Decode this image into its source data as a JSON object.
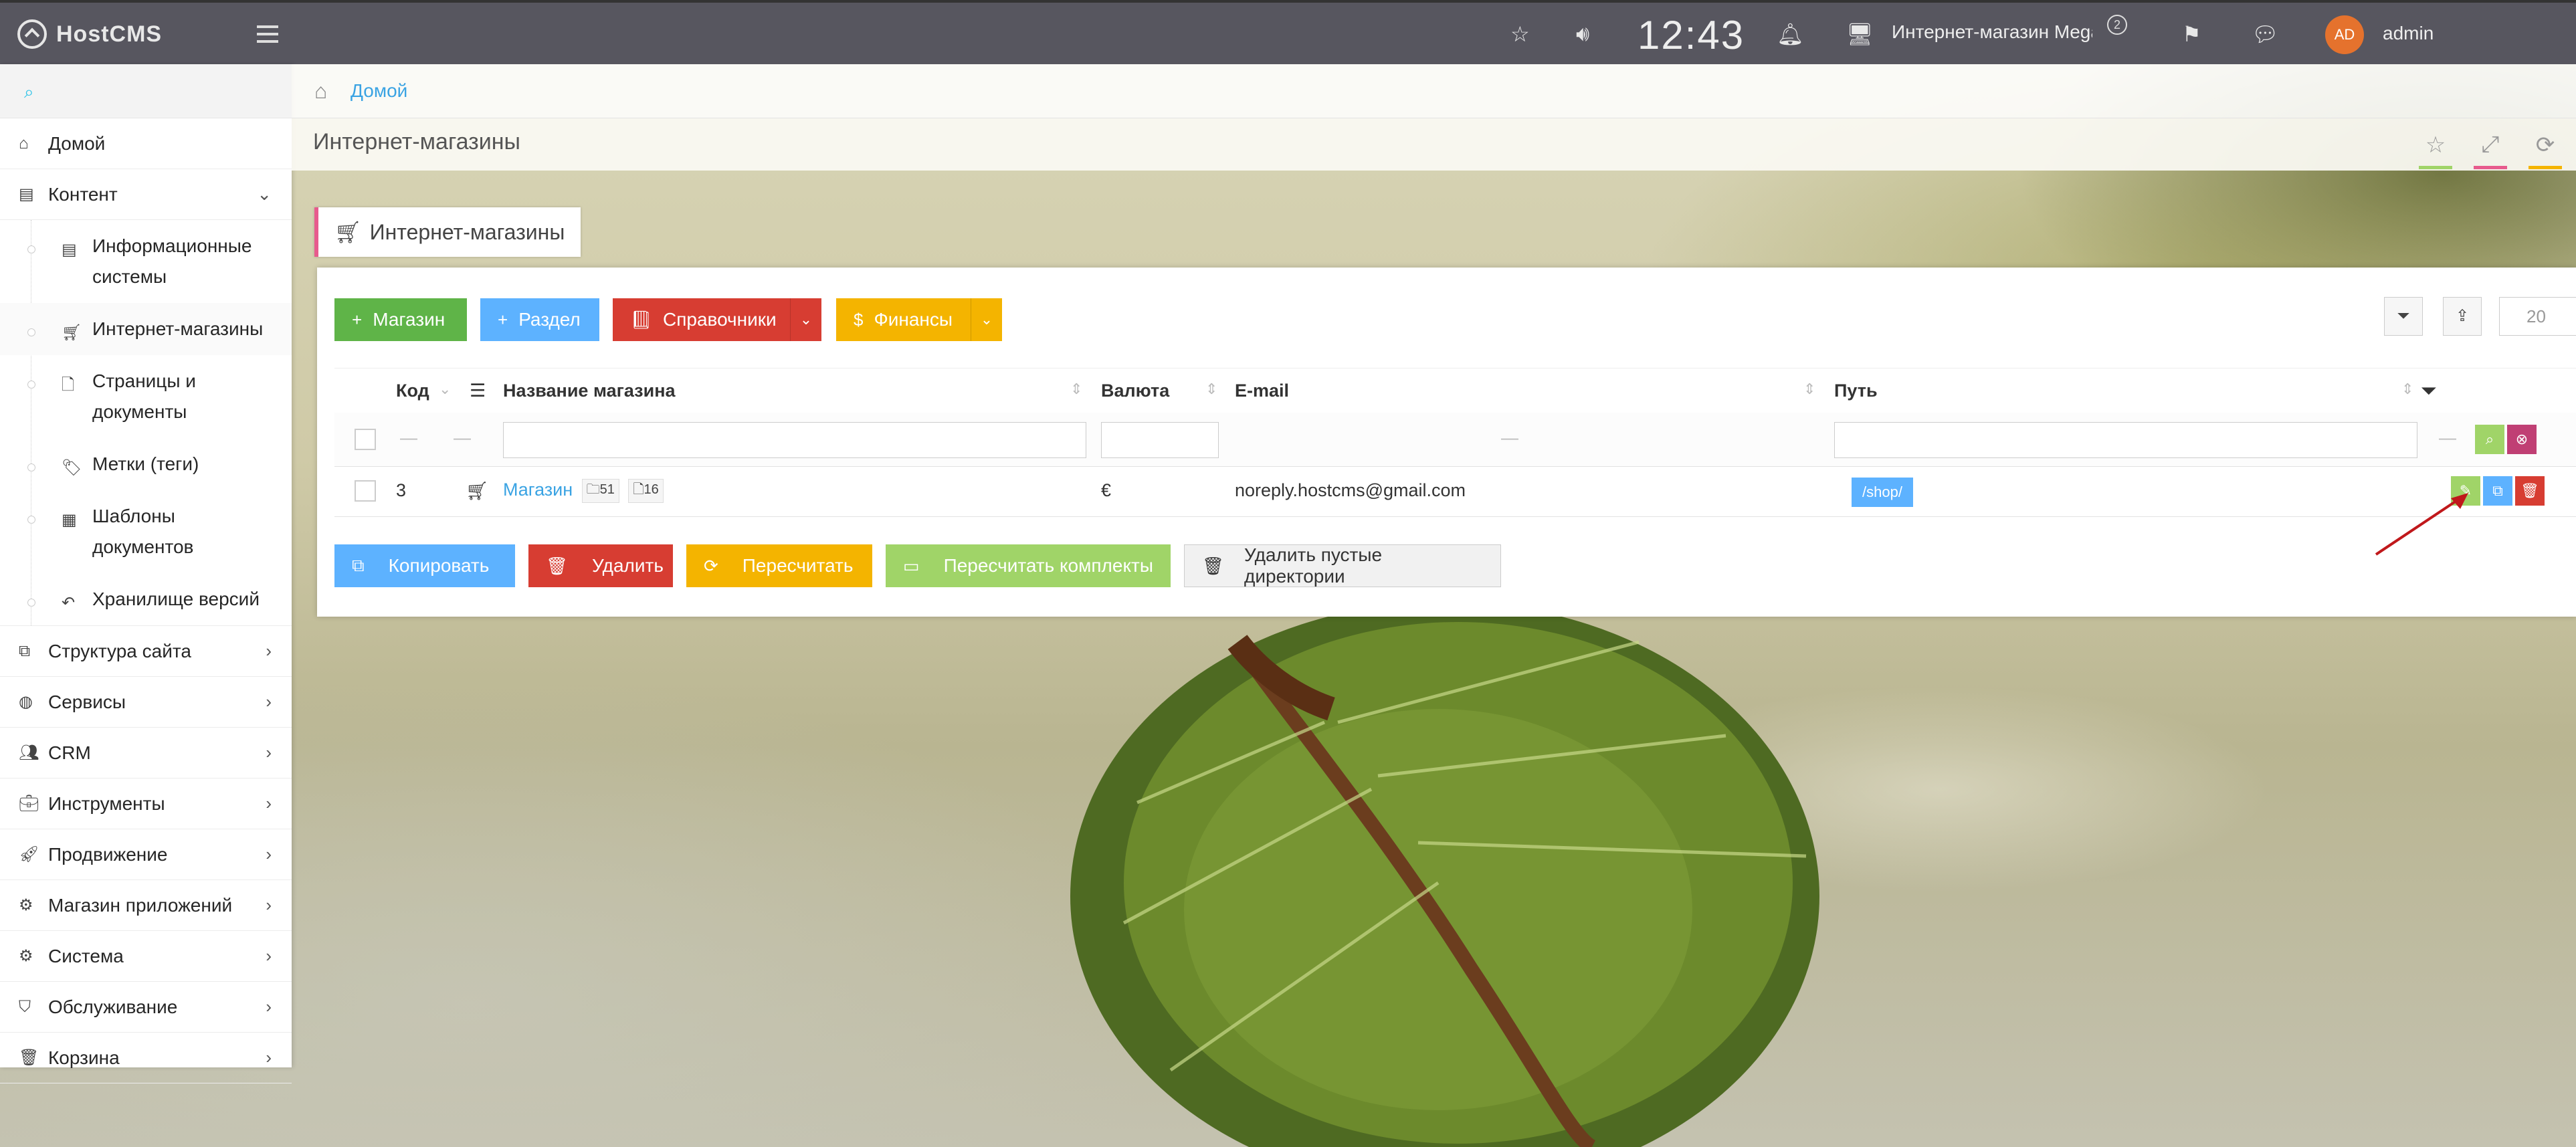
{
  "navbar": {
    "logo_text": "HostCMS",
    "clock": "12:43",
    "shop_name": "Интернет-магазин Mega",
    "shop_badge": "2",
    "avatar_initials": "AD",
    "username": "admin"
  },
  "sidebar": {
    "search_icon": "search-icon",
    "items": [
      {
        "label": "Домой",
        "icon": "home-icon"
      },
      {
        "label": "Контент",
        "icon": "newspaper-icon",
        "expanded": true
      }
    ],
    "sub_items": [
      {
        "label_line1": "Информационные",
        "label_line2": "системы",
        "icon": "newspaper-icon"
      },
      {
        "label_line1": "Интернет-магазины",
        "label_line2": "",
        "icon": "cart-icon",
        "active": true
      },
      {
        "label_line1": "Страницы и",
        "label_line2": "документы",
        "icon": "file-icon"
      },
      {
        "label_line1": "Метки (теги)",
        "label_line2": "",
        "icon": "tags-icon"
      },
      {
        "label_line1": "Шаблоны",
        "label_line2": "документов",
        "icon": "template-icon"
      },
      {
        "label_line1": "Хранилище версий",
        "label_line2": "",
        "icon": "undo-icon"
      }
    ],
    "bottom_items": [
      {
        "label": "Структура сайта",
        "icon": "sitemap-icon"
      },
      {
        "label": "Сервисы",
        "icon": "globe-icon"
      },
      {
        "label": "CRM",
        "icon": "users-icon"
      },
      {
        "label": "Инструменты",
        "icon": "briefcase-icon"
      },
      {
        "label": "Продвижение",
        "icon": "rocket-icon"
      },
      {
        "label": "Магазин приложений",
        "icon": "cogs-icon"
      },
      {
        "label": "Система",
        "icon": "gear-icon"
      },
      {
        "label": "Обслуживание",
        "icon": "shield-icon"
      },
      {
        "label": "Корзина",
        "icon": "trash-icon"
      }
    ]
  },
  "breadcrumb": {
    "home": "Домой"
  },
  "page": {
    "title": "Интернет-магазины"
  },
  "widget": {
    "caption": "Интернет-магазины",
    "buttons": {
      "shop": "Магазин",
      "section": "Раздел",
      "references": "Справочники",
      "finance": "Финансы"
    },
    "page_size": "20",
    "columns": {
      "id": "Код",
      "name": "Название магазина",
      "currency": "Валюта",
      "email": "E-mail",
      "path": "Путь"
    },
    "row": {
      "id": "3",
      "name": "Магазин",
      "dirs": "51",
      "items": "16",
      "currency": "€",
      "email": "noreply.hostcms@gmail.com",
      "path": "/shop/"
    },
    "filter_dash": "—",
    "actions": {
      "copy": "Копировать",
      "delete": "Удалить",
      "recount": "Пересчитать",
      "recount_sets": "Пересчитать комплекты",
      "delete_empty_dirs": "Удалить пустые директории"
    }
  },
  "colors": {
    "green": "#5fb448",
    "blue": "#5db2ff",
    "red": "#d73d32",
    "yellow": "#f4b400",
    "light_green": "#a0d468",
    "pink": "#e75b8d",
    "navbar": "#57565f"
  }
}
